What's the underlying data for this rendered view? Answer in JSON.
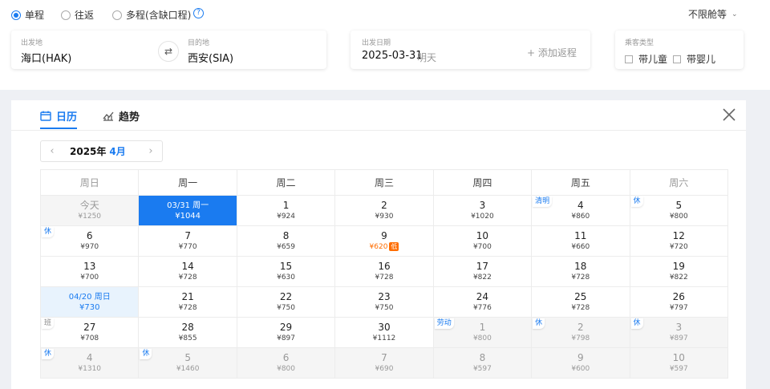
{
  "trip_types": [
    {
      "label": "单程",
      "checked": true
    },
    {
      "label": "往返",
      "checked": false
    },
    {
      "label": "多程(含缺口程)",
      "checked": false
    }
  ],
  "help_icon": "?",
  "cabin_label": "不限舱等",
  "search": {
    "from_label": "出发地",
    "from_value": "海口(HAK)",
    "to_label": "目的地",
    "to_value": "西安(SIA)",
    "date_label": "出发日期",
    "date_value": "2025-03-31",
    "date_hint": "明天",
    "add_return": "+ 添加返程",
    "passenger_label": "乘客类型",
    "child": "带儿童",
    "infant": "带婴儿"
  },
  "tabs": {
    "calendar": "日历",
    "trend": "趋势"
  },
  "month_nav": {
    "prev": "‹",
    "year": "2025年",
    "month": "4月",
    "next": "›"
  },
  "weekdays": [
    "周日",
    "周一",
    "周二",
    "周三",
    "周四",
    "周五",
    "周六"
  ],
  "weeks": [
    [
      {
        "d": "今天",
        "p": "¥1250",
        "state": "past"
      },
      {
        "d": "03/31 周一",
        "p": "¥1044",
        "state": "sel"
      },
      {
        "d": "1",
        "p": "¥924"
      },
      {
        "d": "2",
        "p": "¥930"
      },
      {
        "d": "3",
        "p": "¥1020"
      },
      {
        "d": "4",
        "p": "¥860",
        "tag": "清明",
        "tagtype": "fest"
      },
      {
        "d": "5",
        "p": "¥800",
        "tag": "休",
        "tagtype": "rest"
      }
    ],
    [
      {
        "d": "6",
        "p": "¥970",
        "tag": "休",
        "tagtype": "rest"
      },
      {
        "d": "7",
        "p": "¥770"
      },
      {
        "d": "8",
        "p": "¥659"
      },
      {
        "d": "9",
        "p": "¥620",
        "low": true,
        "lowtag": "低"
      },
      {
        "d": "10",
        "p": "¥700"
      },
      {
        "d": "11",
        "p": "¥660"
      },
      {
        "d": "12",
        "p": "¥720"
      }
    ],
    [
      {
        "d": "13",
        "p": "¥700"
      },
      {
        "d": "14",
        "p": "¥728"
      },
      {
        "d": "15",
        "p": "¥630"
      },
      {
        "d": "16",
        "p": "¥728"
      },
      {
        "d": "17",
        "p": "¥822"
      },
      {
        "d": "18",
        "p": "¥728"
      },
      {
        "d": "19",
        "p": "¥822"
      }
    ],
    [
      {
        "d": "04/20 周日",
        "p": "¥730",
        "state": "ret"
      },
      {
        "d": "21",
        "p": "¥728"
      },
      {
        "d": "22",
        "p": "¥750"
      },
      {
        "d": "23",
        "p": "¥750"
      },
      {
        "d": "24",
        "p": "¥776"
      },
      {
        "d": "25",
        "p": "¥728"
      },
      {
        "d": "26",
        "p": "¥797"
      }
    ],
    [
      {
        "d": "27",
        "p": "¥708",
        "tag": "班",
        "tagtype": "work"
      },
      {
        "d": "28",
        "p": "¥855"
      },
      {
        "d": "29",
        "p": "¥897"
      },
      {
        "d": "30",
        "p": "¥1112"
      },
      {
        "d": "1",
        "p": "¥800",
        "state": "out",
        "tag": "劳动",
        "tagtype": "fest"
      },
      {
        "d": "2",
        "p": "¥798",
        "state": "out",
        "tag": "休",
        "tagtype": "rest"
      },
      {
        "d": "3",
        "p": "¥897",
        "state": "out",
        "tag": "休",
        "tagtype": "rest"
      }
    ],
    [
      {
        "d": "4",
        "p": "¥1310",
        "state": "out",
        "tag": "休",
        "tagtype": "rest"
      },
      {
        "d": "5",
        "p": "¥1460",
        "state": "out",
        "tag": "休",
        "tagtype": "rest"
      },
      {
        "d": "6",
        "p": "¥800",
        "state": "out"
      },
      {
        "d": "7",
        "p": "¥690",
        "state": "out"
      },
      {
        "d": "8",
        "p": "¥597",
        "state": "out"
      },
      {
        "d": "9",
        "p": "¥600",
        "state": "out"
      },
      {
        "d": "10",
        "p": "¥597",
        "state": "out"
      }
    ]
  ],
  "colors": {
    "accent": "#1a7bf0",
    "low": "#ff6d00"
  }
}
